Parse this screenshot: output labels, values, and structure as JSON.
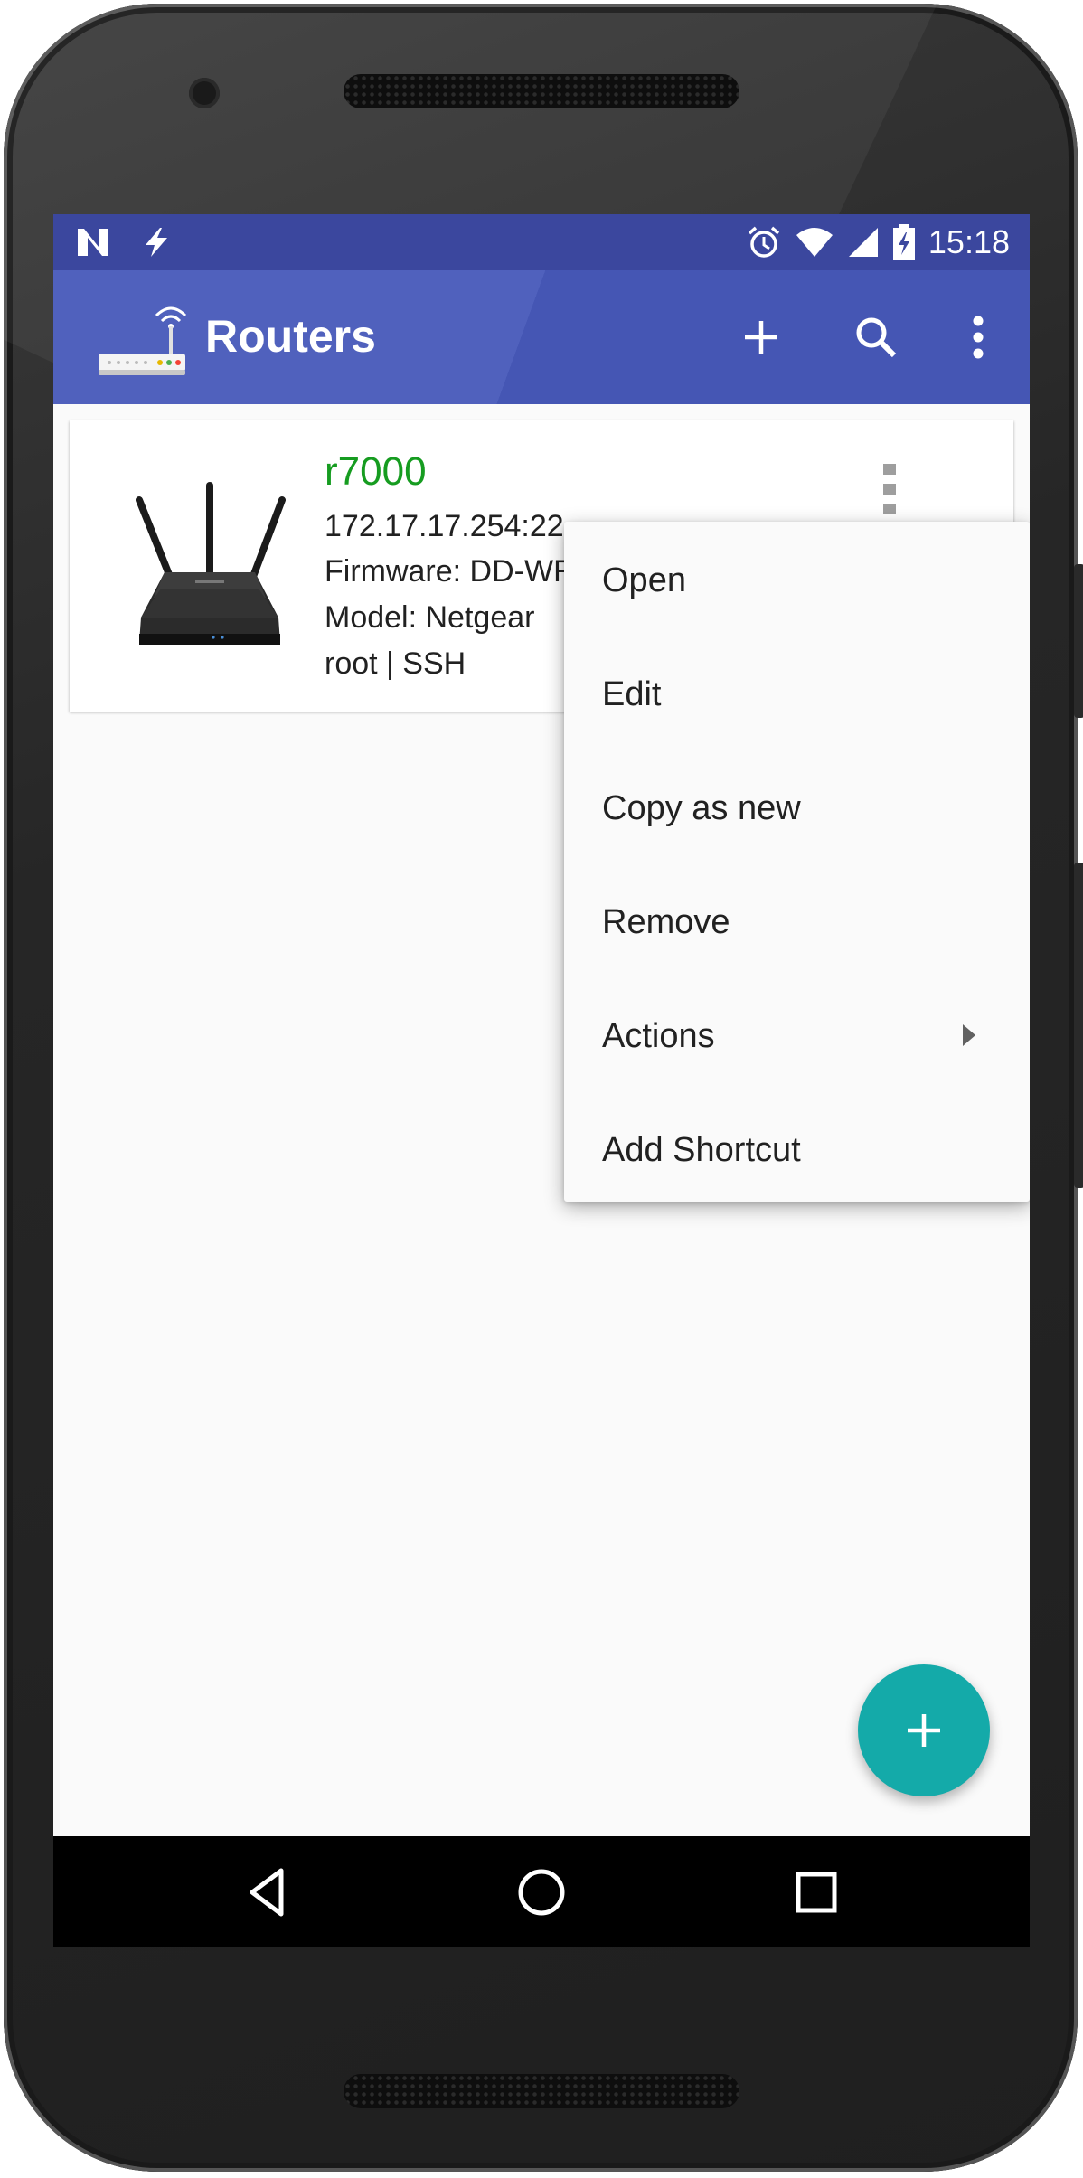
{
  "status_bar": {
    "time": "15:18",
    "left_icons": [
      "n-notification-icon",
      "bolt-icon"
    ],
    "right_icons": [
      "alarm-icon",
      "wifi-icon",
      "cell-signal-icon",
      "battery-charging-icon"
    ]
  },
  "app_bar": {
    "title": "Routers",
    "actions": [
      "add-icon",
      "search-icon",
      "overflow-menu-icon"
    ],
    "color": "#5061bd"
  },
  "router_card": {
    "name": "r7000",
    "name_color": "#169c20",
    "address": "172.17.17.254:22",
    "firmware": "Firmware: DD-WRT",
    "model": "Model: Netgear",
    "login": "root | SSH"
  },
  "context_menu": {
    "items": [
      {
        "label": "Open"
      },
      {
        "label": "Edit"
      },
      {
        "label": "Copy as new"
      },
      {
        "label": "Remove"
      },
      {
        "label": "Actions",
        "has_submenu": true
      },
      {
        "label": "Add Shortcut"
      }
    ]
  },
  "fab": {
    "icon": "add-icon",
    "color": "#14aaa9"
  },
  "nav_bar": {
    "buttons": [
      "back-icon",
      "home-icon",
      "recents-icon"
    ]
  }
}
